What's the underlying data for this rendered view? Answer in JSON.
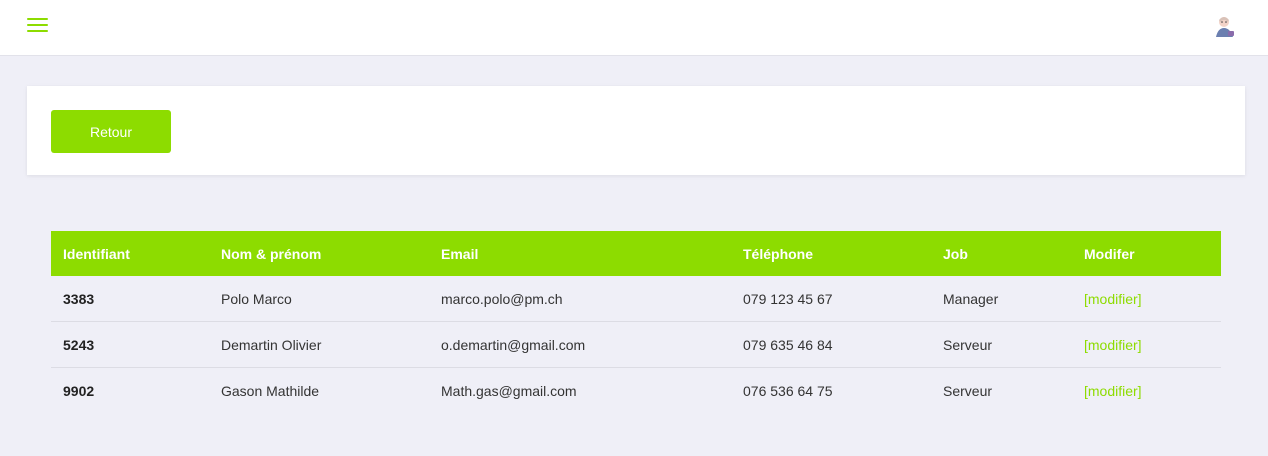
{
  "colors": {
    "accent": "#8ddc00",
    "background": "#efeff7"
  },
  "topbar": {
    "menu_icon": "hamburger-menu-icon",
    "avatar_icon": "user-avatar-icon"
  },
  "actions": {
    "back_label": "Retour"
  },
  "table": {
    "headers": [
      "Identifiant",
      "Nom & prénom",
      "Email",
      "Téléphone",
      "Job",
      "Modifer"
    ],
    "rows": [
      {
        "id": "3383",
        "name": "Polo Marco",
        "email": "marco.polo@pm.ch",
        "phone": "079 123 45 67",
        "job": "Manager",
        "action": "[modifier]"
      },
      {
        "id": "5243",
        "name": "Demartin Olivier",
        "email": "o.demartin@gmail.com",
        "phone": "079 635 46 84",
        "job": "Serveur",
        "action": "[modifier]"
      },
      {
        "id": "9902",
        "name": "Gason Mathilde",
        "email": "Math.gas@gmail.com",
        "phone": "076 536 64 75",
        "job": "Serveur",
        "action": "[modifier]"
      }
    ]
  }
}
